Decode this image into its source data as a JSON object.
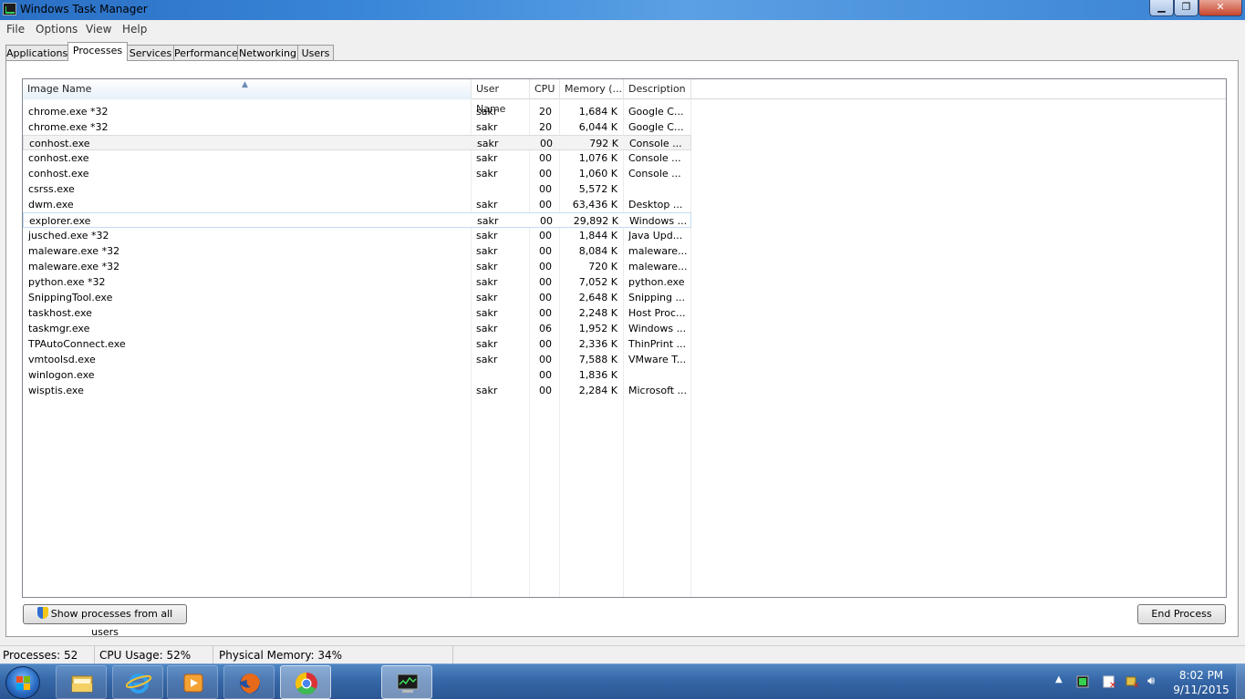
{
  "window": {
    "title": "Windows Task Manager"
  },
  "menu": [
    "File",
    "Options",
    "View",
    "Help"
  ],
  "tabs": [
    "Applications",
    "Processes",
    "Services",
    "Performance",
    "Networking",
    "Users"
  ],
  "columns": [
    "Image Name",
    "User Name",
    "CPU",
    "Memory (...",
    "Description"
  ],
  "processes": [
    {
      "name": "chrome.exe *32",
      "user": "sakr",
      "cpu": "20",
      "mem": "1,684 K",
      "desc": "Google C..."
    },
    {
      "name": "chrome.exe *32",
      "user": "sakr",
      "cpu": "20",
      "mem": "6,044 K",
      "desc": "Google C..."
    },
    {
      "name": "conhost.exe",
      "user": "sakr",
      "cpu": "00",
      "mem": "792 K",
      "desc": "Console ..."
    },
    {
      "name": "conhost.exe",
      "user": "sakr",
      "cpu": "00",
      "mem": "1,076 K",
      "desc": "Console ..."
    },
    {
      "name": "conhost.exe",
      "user": "sakr",
      "cpu": "00",
      "mem": "1,060 K",
      "desc": "Console ..."
    },
    {
      "name": "csrss.exe",
      "user": "",
      "cpu": "00",
      "mem": "5,572 K",
      "desc": ""
    },
    {
      "name": "dwm.exe",
      "user": "sakr",
      "cpu": "00",
      "mem": "63,436 K",
      "desc": "Desktop ..."
    },
    {
      "name": "explorer.exe",
      "user": "sakr",
      "cpu": "00",
      "mem": "29,892 K",
      "desc": "Windows ..."
    },
    {
      "name": "jusched.exe *32",
      "user": "sakr",
      "cpu": "00",
      "mem": "1,844 K",
      "desc": "Java Upd..."
    },
    {
      "name": "maleware.exe *32",
      "user": "sakr",
      "cpu": "00",
      "mem": "8,084 K",
      "desc": "maleware..."
    },
    {
      "name": "maleware.exe *32",
      "user": "sakr",
      "cpu": "00",
      "mem": "720 K",
      "desc": "maleware..."
    },
    {
      "name": "python.exe *32",
      "user": "sakr",
      "cpu": "00",
      "mem": "7,052 K",
      "desc": "python.exe"
    },
    {
      "name": "SnippingTool.exe",
      "user": "sakr",
      "cpu": "00",
      "mem": "2,648 K",
      "desc": "Snipping ..."
    },
    {
      "name": "taskhost.exe",
      "user": "sakr",
      "cpu": "00",
      "mem": "2,248 K",
      "desc": "Host Proc..."
    },
    {
      "name": "taskmgr.exe",
      "user": "sakr",
      "cpu": "06",
      "mem": "1,952 K",
      "desc": "Windows ..."
    },
    {
      "name": "TPAutoConnect.exe",
      "user": "sakr",
      "cpu": "00",
      "mem": "2,336 K",
      "desc": "ThinPrint ..."
    },
    {
      "name": "vmtoolsd.exe",
      "user": "sakr",
      "cpu": "00",
      "mem": "7,588 K",
      "desc": "VMware T..."
    },
    {
      "name": "winlogon.exe",
      "user": "",
      "cpu": "00",
      "mem": "1,836 K",
      "desc": ""
    },
    {
      "name": "wisptis.exe",
      "user": "sakr",
      "cpu": "00",
      "mem": "2,284 K",
      "desc": "Microsoft ..."
    }
  ],
  "selected_row": 2,
  "hover_row": 7,
  "buttons": {
    "show_all": "Show processes from all users",
    "end_process": "End Process"
  },
  "status": {
    "processes": "Processes: 52",
    "cpu": "CPU Usage: 52%",
    "memory": "Physical Memory: 34%"
  },
  "taskbar": {
    "apps": [
      "file-explorer-icon",
      "internet-explorer-icon",
      "media-player-icon",
      "firefox-icon",
      "chrome-icon",
      "task-manager-icon"
    ],
    "time": "8:02 PM",
    "date": "9/11/2015"
  },
  "colors": {
    "titlebar": "#3a86d8",
    "taskbar": "#3667a8",
    "selected_border": "#c3dcf3"
  }
}
